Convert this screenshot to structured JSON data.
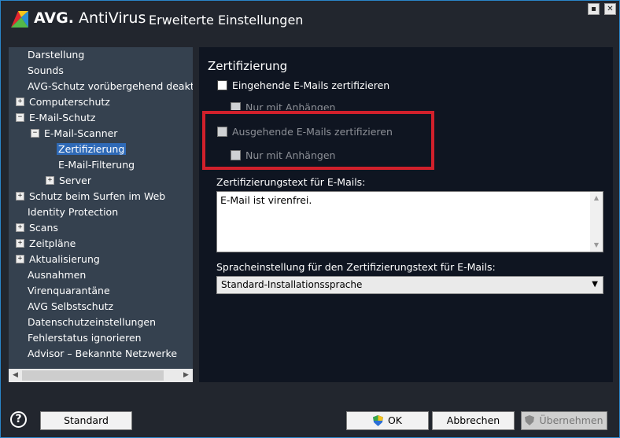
{
  "window": {
    "brand_bold": "AVG.",
    "brand_rest": " AntiVirus",
    "title": "Erweiterte Einstellungen",
    "minimize_label": "▪",
    "close_label": "✕"
  },
  "sidebar": {
    "items": [
      {
        "label": "Darstellung",
        "expander": ""
      },
      {
        "label": "Sounds",
        "expander": ""
      },
      {
        "label": "AVG-Schutz vorübergehend deaktivieren",
        "expander": ""
      },
      {
        "label": "Computerschutz",
        "expander": "+"
      },
      {
        "label": "E-Mail-Schutz",
        "expander": "−"
      },
      {
        "label": "E-Mail-Scanner",
        "expander": "−"
      },
      {
        "label": "Zertifizierung",
        "expander": ""
      },
      {
        "label": "E-Mail-Filterung",
        "expander": ""
      },
      {
        "label": "Server",
        "expander": "+"
      },
      {
        "label": "Schutz beim Surfen im Web",
        "expander": "+"
      },
      {
        "label": "Identity Protection",
        "expander": ""
      },
      {
        "label": "Scans",
        "expander": "+"
      },
      {
        "label": "Zeitpläne",
        "expander": "+"
      },
      {
        "label": "Aktualisierung",
        "expander": "+"
      },
      {
        "label": "Ausnahmen",
        "expander": ""
      },
      {
        "label": "Virenquarantäne",
        "expander": ""
      },
      {
        "label": "AVG Selbstschutz",
        "expander": ""
      },
      {
        "label": "Datenschutzeinstellungen",
        "expander": ""
      },
      {
        "label": "Fehlerstatus ignorieren",
        "expander": ""
      },
      {
        "label": "Advisor – Bekannte Netzwerke",
        "expander": ""
      }
    ],
    "selected": "Zertifizierung"
  },
  "panel": {
    "section_title": "Zertifizierung",
    "incoming_label": "Eingehende E-Mails zertifizieren",
    "incoming_attach_label": "Nur mit Anhängen",
    "outgoing_label": "Ausgehende E-Mails zertifizieren",
    "outgoing_attach_label": "Nur mit Anhängen",
    "cert_text_label": "Zertifizierungstext für E-Mails:",
    "cert_text_value": "E-Mail ist virenfrei.",
    "language_label": "Spracheinstellung für den Zertifizierungstext für E-Mails:",
    "language_value": "Standard-Installationssprache"
  },
  "footer": {
    "help_label": "?",
    "standard_label": "Standard",
    "ok_label": "OK",
    "cancel_label": "Abbrechen",
    "apply_label": "Übernehmen"
  },
  "colors": {
    "selection": "#2f6ab7",
    "highlight_border": "#d1202b",
    "sidebar_bg": "#35414f",
    "panel_bg": "#0f1521"
  }
}
